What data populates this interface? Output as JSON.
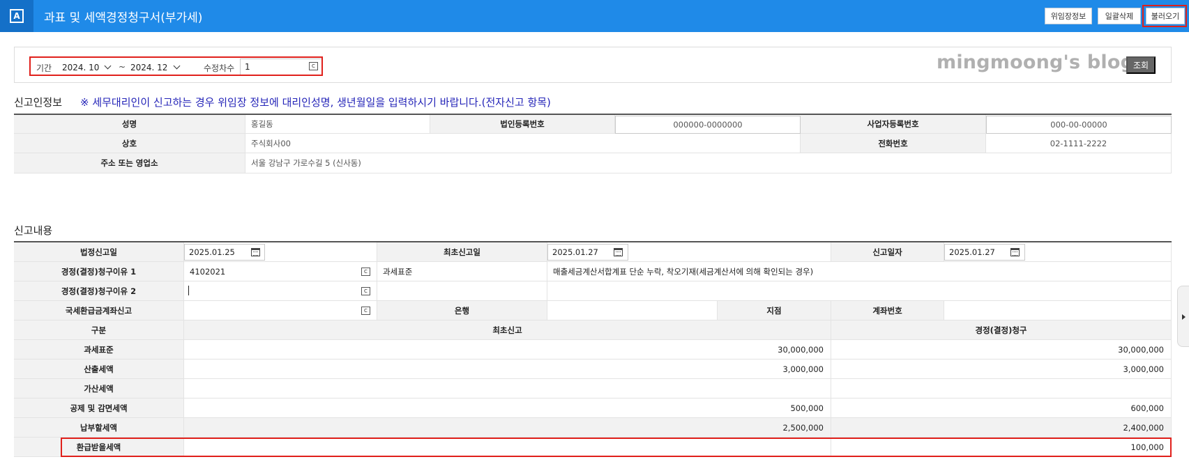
{
  "header": {
    "app_icon": "A",
    "title": "과표 및 세액경정청구서(부가세)",
    "buttons": {
      "delegate_info": "위임장정보",
      "bulk_delete": "일괄삭제",
      "load": "불러오기"
    }
  },
  "filter": {
    "period_label": "기간",
    "from": "2024. 10",
    "sep": "~",
    "to": "2024. 12",
    "revision_label": "수정차수",
    "revision_value": "1",
    "search_button": "조회"
  },
  "watermark": "mingmoong's blog",
  "report_info": {
    "title": "신고인정보",
    "notice": "※ 세무대리인이 신고하는 경우 위임장 정보에 대리인성명, 생년월일을 입력하시기 바랍니다.(전자신고 항목)",
    "name_label": "성명",
    "name_value": "홍길동",
    "corp_reg_label": "법인등록번호",
    "corp_reg_value": "000000-0000000",
    "biz_reg_label": "사업자등록번호",
    "biz_reg_value": "000-00-00000",
    "company_label": "상호",
    "company_value": "주식회사00",
    "phone_label": "전화번호",
    "phone_value": "02-1111-2222",
    "address_label": "주소 또는 영업소",
    "address_value": "서울 강남구 가로수길 5 (신사동)"
  },
  "report_content": {
    "title": "신고내용",
    "legal_date_label": "법정신고일",
    "legal_date_value": "2025.01.25",
    "initial_date_label": "최초신고일",
    "initial_date_value": "2025.01.27",
    "report_date_label": "신고일자",
    "report_date_value": "2025.01.27",
    "reason1_label": "경정(결정)청구이유 1",
    "reason1_code": "4102021",
    "reason1_category": "과세표준",
    "reason1_desc": "매출세금계산서합계표 단순 누락, 착오기재(세금계산서에 의해 확인되는 경우)",
    "reason2_label": "경정(결정)청구이유 2",
    "refund_account_label": "국세환급금계좌신고",
    "bank_label": "은행",
    "branch_label": "지점",
    "account_label": "계좌번호",
    "col_category": "구분",
    "col_initial": "최초신고",
    "col_claim": "경정(결정)청구",
    "rows": [
      {
        "label": "과세표준",
        "initial": "30,000,000",
        "claim": "30,000,000"
      },
      {
        "label": "산출세액",
        "initial": "3,000,000",
        "claim": "3,000,000"
      },
      {
        "label": "가산세액",
        "initial": "",
        "claim": ""
      },
      {
        "label": "공제 및 감면세액",
        "initial": "500,000",
        "claim": "600,000"
      },
      {
        "label": "납부할세액",
        "initial": "2,500,000",
        "claim": "2,400,000"
      },
      {
        "label": "환급받을세액",
        "initial": "",
        "claim": "100,000"
      }
    ]
  },
  "colors": {
    "header_bg": "#1f8ae8",
    "highlight": "#e0201b",
    "notice": "#2424b8"
  }
}
